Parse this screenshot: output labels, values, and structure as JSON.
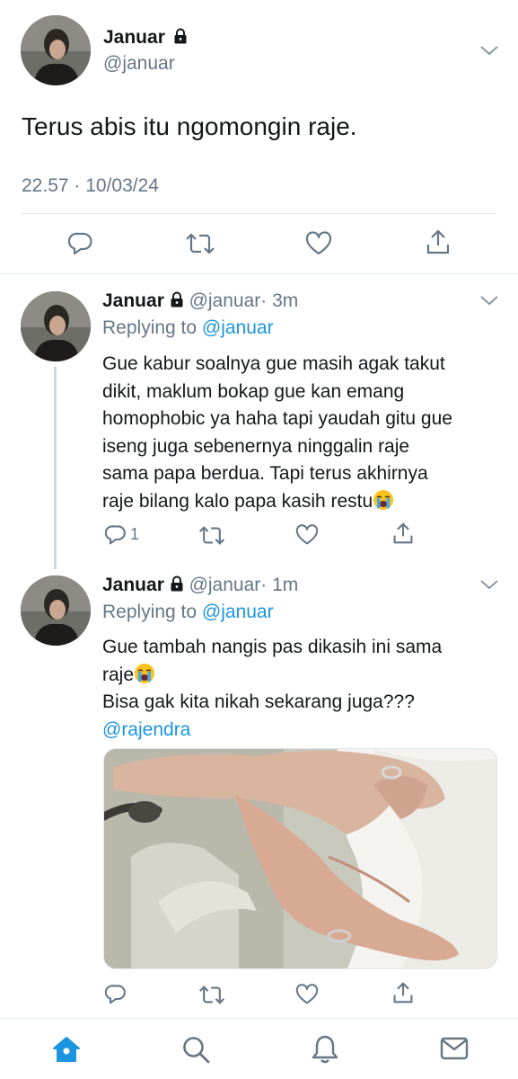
{
  "main_tweet": {
    "name": "Januar",
    "handle": "@januar",
    "text": "Terus abis itu ngomongin raje.",
    "timestamp": "22.57 · 10/03/24"
  },
  "reply1": {
    "name": "Januar",
    "handle": "@januar",
    "time": "· 3m",
    "replying_prefix": "Replying to",
    "replying_handle": "@januar",
    "lines": [
      "Gue kabur soalnya gue masih agak takut",
      "dikit, maklum bokap gue kan emang",
      "homophobic ya haha tapi yaudah gitu gue",
      "iseng juga sebenernya ninggalin raje",
      "sama papa berdua. Tapi terus akhirnya",
      "raje bilang kalo papa kasih restu"
    ],
    "reply_count": "1"
  },
  "reply2": {
    "name": "Januar",
    "handle": "@januar",
    "time": "· 1m",
    "replying_prefix": "Replying to",
    "replying_handle": "@januar",
    "lines": [
      "Gue tambah nangis pas dikasih ini sama",
      "raje",
      "Bisa gak kita nikah sekarang juga???"
    ],
    "mention": "@rajendra"
  },
  "icons": {
    "reply": "reply-icon",
    "retweet": "retweet-icon",
    "like": "like-icon",
    "share": "share-icon",
    "lock": "lock-icon",
    "crying_emoji": "loudly-crying-face-emoji",
    "home": "home-icon",
    "search": "search-icon",
    "notifications": "bell-icon",
    "messages": "mail-icon"
  },
  "colors": {
    "accent": "#1b95e0",
    "text": "#14171a",
    "muted": "#657786",
    "divider": "#e1e8ed"
  }
}
